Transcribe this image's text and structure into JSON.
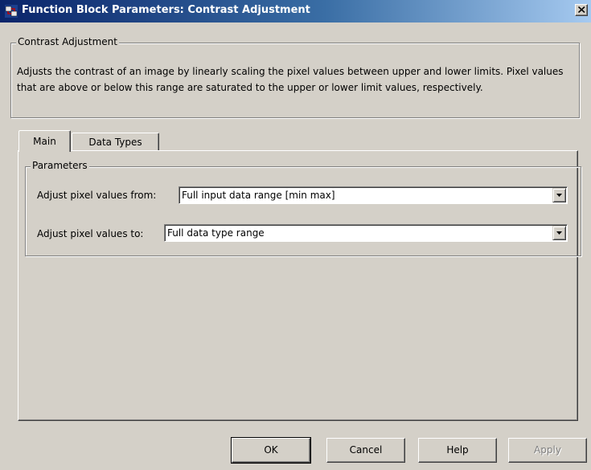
{
  "window": {
    "title": "Function Block Parameters: Contrast Adjustment"
  },
  "block": {
    "group_title": "Contrast Adjustment",
    "description": "Adjusts the contrast of an image by linearly scaling the pixel values between upper and lower limits. Pixel values that are above or below this range are saturated to the upper or lower limit values, respectively."
  },
  "tabs": [
    {
      "label": "Main",
      "selected": true
    },
    {
      "label": "Data Types",
      "selected": false
    }
  ],
  "parameters": {
    "group_title": "Parameters",
    "fields": [
      {
        "label": "Adjust pixel values from:",
        "value": "Full input data range [min max]"
      },
      {
        "label": "Adjust pixel values to:",
        "value": "Full data type range"
      }
    ]
  },
  "buttons": {
    "ok": "OK",
    "cancel": "Cancel",
    "help": "Help",
    "apply": "Apply"
  },
  "colors": {
    "titlebar_start": "#0a246a",
    "titlebar_end": "#a6caf0",
    "dialog_bg": "#d4d0c8"
  }
}
